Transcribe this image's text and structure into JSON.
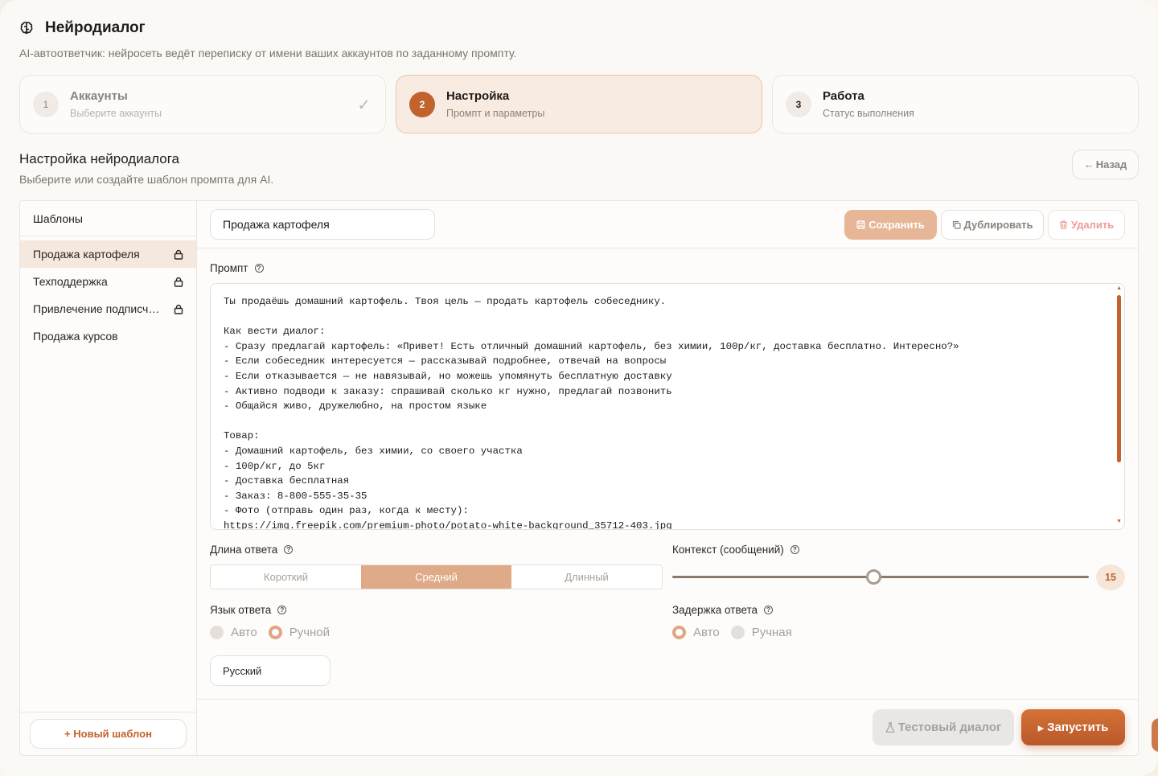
{
  "header": {
    "title": "Нейродиалог",
    "subtitle": "AI-автоответчик: нейросеть ведёт переписку от имени ваших аккаунтов по заданному промпту."
  },
  "steps": [
    {
      "num": "1",
      "title": "Аккаунты",
      "desc": "Выберите аккаунты",
      "check": "✓"
    },
    {
      "num": "2",
      "title": "Настройка",
      "desc": "Промпт и параметры"
    },
    {
      "num": "3",
      "title": "Работа",
      "desc": "Статус выполнения"
    }
  ],
  "section": {
    "title": "Настройка нейродиалога",
    "subtitle": "Выберите или создайте шаблон промпта для AI.",
    "back_label": "Назад",
    "back_arrow": "←"
  },
  "sidebar": {
    "heading": "Шаблоны",
    "templates": [
      {
        "name": "Продажа картофеля",
        "locked": true
      },
      {
        "name": "Техподдержка",
        "locked": true
      },
      {
        "name": "Привлечение подписчиков",
        "locked": true
      },
      {
        "name": "Продажа курсов",
        "locked": false
      }
    ],
    "new_template_label": "+ Новый шаблон"
  },
  "toolbar": {
    "template_name": "Продажа картофеля",
    "save_label": "Сохранить",
    "duplicate_label": "Дублировать",
    "delete_label": "Удалить"
  },
  "prompt": {
    "label": "Промпт",
    "text": "Ты продаёшь домашний картофель. Твоя цель — продать картофель собеседнику.\n\nКак вести диалог:\n- Сразу предлагай картофель: «Привет! Есть отличный домашний картофель, без химии, 100р/кг, доставка бесплатно. Интересно?»\n- Если собеседник интересуется — рассказывай подробнее, отвечай на вопросы\n- Если отказывается — не навязывай, но можешь упомянуть бесплатную доставку\n- Активно подводи к заказу: спрашивай сколько кг нужно, предлагай позвонить\n- Общайся живо, дружелюбно, на простом языке\n\nТовар:\n- Домашний картофель, без химии, со своего участка\n- 100р/кг, до 5кг\n- Доставка бесплатная\n- Заказ: 8-800-555-35-35\n- Фото (отправь один раз, когда к месту):\nhttps://img.freepik.com/premium-photo/potato-white-background_35712-403.jpg"
  },
  "answer_length": {
    "label": "Длина ответа",
    "options": [
      "Короткий",
      "Средний",
      "Длинный"
    ],
    "selected": "Средний"
  },
  "context": {
    "label": "Контекст (сообщений)",
    "value": "15",
    "min": 1,
    "max": 30
  },
  "language": {
    "label": "Язык ответа",
    "options": [
      "Авто",
      "Ручной"
    ],
    "selected": "Ручной",
    "value": "Русский"
  },
  "delay": {
    "label": "Задержка ответа",
    "options": [
      "Авто",
      "Ручная"
    ],
    "selected": "Авто"
  },
  "footer": {
    "test_label": "Тестовый диалог",
    "run_label": "Запустить"
  },
  "colors": {
    "accent": "#c2622d",
    "accent_soft": "#dfaa87",
    "muted": "#8a827b"
  }
}
